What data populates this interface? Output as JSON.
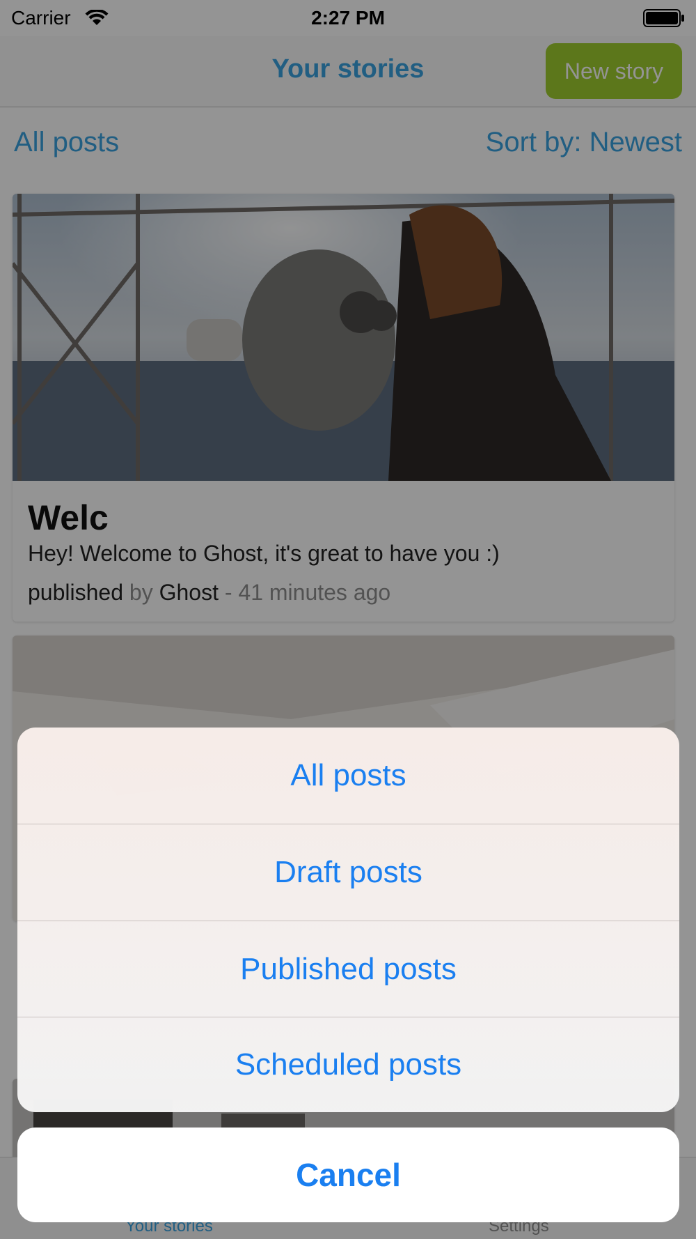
{
  "status_bar": {
    "carrier": "Carrier",
    "time": "2:27 PM",
    "icons": [
      "wifi-icon",
      "battery-icon"
    ]
  },
  "nav": {
    "title": "Your stories",
    "new_story_label": "New story",
    "accent_color": "#3aa2e0",
    "button_color": "#9fce2f"
  },
  "filters": {
    "current_filter": "All posts",
    "sort_label": "Sort by: Newest"
  },
  "posts": [
    {
      "title": "Welc",
      "excerpt": "Hey! Welcome to Ghost, it's great to have you :)",
      "status": "published",
      "by": "by",
      "author": "Ghost",
      "time_ago": "- 41 minutes ago"
    }
  ],
  "tabs": {
    "stories": "Your stories",
    "settings": "Settings"
  },
  "action_sheet": {
    "options": [
      "All posts",
      "Draft posts",
      "Published posts",
      "Scheduled posts"
    ],
    "cancel_label": "Cancel",
    "action_color": "#1a7ff0"
  }
}
